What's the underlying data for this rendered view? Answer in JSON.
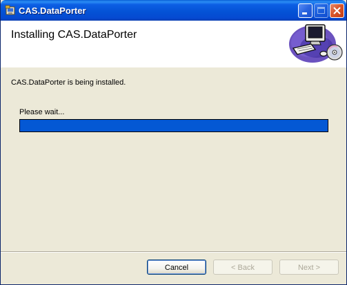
{
  "window": {
    "title": "CAS.DataPorter"
  },
  "banner": {
    "title": "Installing CAS.DataPorter"
  },
  "body": {
    "status": "CAS.DataPorter is being installed.",
    "wait_label": "Please wait...",
    "progress_fraction": 1.0
  },
  "buttons": {
    "cancel": "Cancel",
    "back": "< Back",
    "next": "Next >"
  },
  "colors": {
    "progress": "#0458d4",
    "titlebar": "#0453d6",
    "face": "#ece9d8"
  },
  "icons": {
    "app": "installer-icon",
    "banner": "computer-cd-icon"
  }
}
